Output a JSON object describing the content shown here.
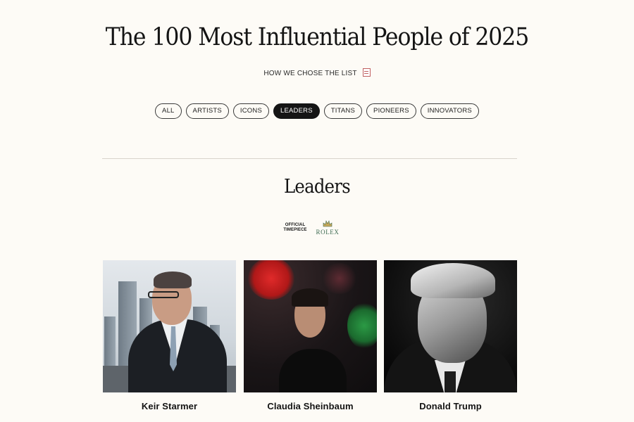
{
  "page": {
    "title": "The 100 Most Influential People of 2025",
    "method_link": "HOW WE CHOSE THE LIST",
    "method_icon": "document-icon"
  },
  "filters": {
    "items": [
      "ALL",
      "ARTISTS",
      "ICONS",
      "LEADERS",
      "TITANS",
      "PIONEERS",
      "INNOVATORS"
    ],
    "active": "LEADERS"
  },
  "section": {
    "title": "Leaders",
    "sponsor": {
      "label_line1": "OFFICIAL",
      "label_line2": "TIMEPIECE",
      "brand": "ROLEX",
      "brand_color": "#3d6b52"
    }
  },
  "people": [
    {
      "name": "Keir Starmer"
    },
    {
      "name": "Claudia Sheinbaum"
    },
    {
      "name": "Donald Trump"
    }
  ],
  "colors": {
    "background": "#fdfbf6",
    "active_pill": "#151515",
    "accent_icon": "#c06060"
  }
}
